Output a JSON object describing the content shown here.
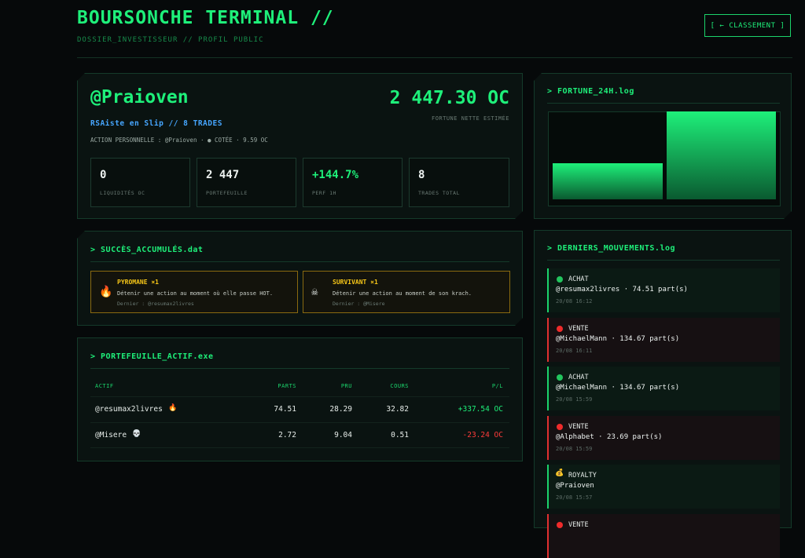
{
  "header": {
    "title": "BOURSONCHE TERMINAL //",
    "subtitle": "DOSSIER_INVESTISSEUR // PROFIL PUBLIC",
    "ranking_button": "[ ← CLASSEMENT ]"
  },
  "profile": {
    "handle": "@Praioven",
    "tagline": "RSAiste en Slip // 8 TRADES",
    "action_line": "ACTION PERSONNELLE : @Praioven · ● COTÉE · 9.59 OC",
    "fortune": "2 447.30 OC",
    "fortune_label": "FORTUNE NETTE ESTIMÉE",
    "stats": [
      {
        "value": "0",
        "label": "LIQUIDITÉS OC"
      },
      {
        "value": "2 447",
        "label": "PORTEFEUILLE"
      },
      {
        "value": "+144.7%",
        "label": "PERF 1H"
      },
      {
        "value": "8",
        "label": "TRADES TOTAL"
      }
    ]
  },
  "fortune_chart": {
    "title": "> FORTUNE_24H.log"
  },
  "chart_data": {
    "type": "bar",
    "categories": [
      "",
      ""
    ],
    "values": [
      1000,
      2447.3
    ],
    "title": "",
    "xlabel": "",
    "ylabel": "",
    "ylim": [
      0,
      2550
    ]
  },
  "achievements": {
    "title": "> SUCCÈS_ACCUMULÉS.dat",
    "items": [
      {
        "icon": "fire-icon",
        "glyph": "🔥",
        "name": "PYROMANE ×1",
        "desc": "Détenir une action au moment où elle passe HOT.",
        "last": "Dernier : @resumax2livres"
      },
      {
        "icon": "skull-crossbones-icon",
        "glyph": "☠",
        "name": "SURVIVANT ×1",
        "desc": "Détenir une action au moment de son krach.",
        "last": "Dernier : @Misere"
      }
    ]
  },
  "portfolio": {
    "title": "> PORTEFEUILLE_ACTIF.exe",
    "columns": [
      "ACTIF",
      "PARTS",
      "PRU",
      "COURS",
      "P/L"
    ],
    "rows": [
      {
        "asset": "@resumax2livres",
        "icon": "🔥",
        "parts": "74.51",
        "pru": "28.29",
        "cours": "32.82",
        "pl": "+337.54 OC",
        "sign": "pos"
      },
      {
        "asset": "@Misere",
        "icon": "💀",
        "parts": "2.72",
        "pru": "9.04",
        "cours": "0.51",
        "pl": "-23.24 OC",
        "sign": "neg"
      }
    ]
  },
  "movements": {
    "title": "> DERNIERS_MOUVEMENTS.log",
    "items": [
      {
        "type": "ACHAT",
        "kind": "buy",
        "main": "@resumax2livres · 74.51 part(s)",
        "time": "20/08 16:12"
      },
      {
        "type": "VENTE",
        "kind": "sell",
        "main": "@MichaelMann · 134.67 part(s)",
        "time": "20/08 16:11"
      },
      {
        "type": "ACHAT",
        "kind": "buy",
        "main": "@MichaelMann · 134.67 part(s)",
        "time": "20/08 15:59"
      },
      {
        "type": "VENTE",
        "kind": "sell",
        "main": "@Alphabet · 23.69 part(s)",
        "time": "20/08 15:59"
      },
      {
        "type": "ROYALTY",
        "kind": "roy",
        "main": "@Praioven",
        "time": "20/08 15:57"
      },
      {
        "type": "VENTE",
        "kind": "sell",
        "main": "",
        "time": ""
      }
    ]
  },
  "colors": {
    "accent": "#1ef07a",
    "buy": "#22c55e",
    "sell": "#ef2b2b",
    "gold": "#f5c518",
    "link": "#46a6ff"
  }
}
